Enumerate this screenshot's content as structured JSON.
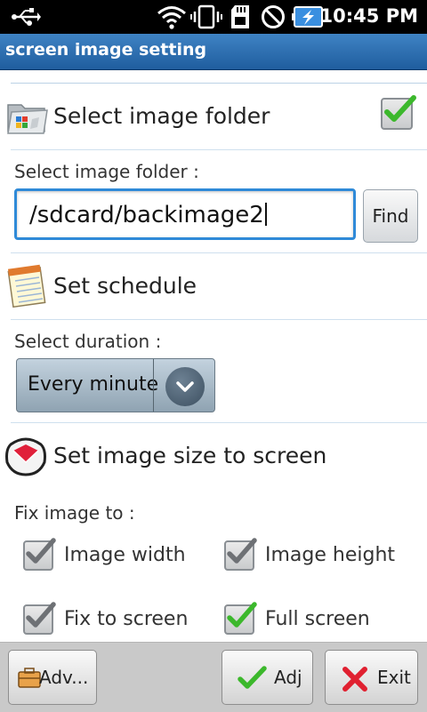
{
  "status_bar": {
    "time": "10:45 PM",
    "icons": [
      "usb-icon",
      "wifi-icon",
      "vibrate-icon",
      "sd-card-icon",
      "no-sound-icon",
      "battery-charging-icon"
    ]
  },
  "titlebar": {
    "title": "screen image setting"
  },
  "folder_section": {
    "title": "Select image folder",
    "checked": true,
    "field_label": "Select image folder :",
    "path_value": "/sdcard/backimage2",
    "find_label": "Find"
  },
  "schedule_section": {
    "title": "Set schedule",
    "duration_label": "Select duration :",
    "duration_value": "Every minute"
  },
  "size_section": {
    "title": "Set image size to screen",
    "fix_label": "Fix image to :",
    "options": [
      {
        "label": "Image width",
        "checked": false
      },
      {
        "label": "Image height",
        "checked": false
      },
      {
        "label": "Fix to screen",
        "checked": false
      },
      {
        "label": "Full screen",
        "checked": true
      }
    ]
  },
  "bottom_bar": {
    "adv_label": "Adv...",
    "adj_label": "Adj",
    "exit_label": "Exit"
  },
  "colors": {
    "title_blue": "#2b6fb3",
    "check_green": "#3cb82c",
    "exit_red": "#e02030",
    "focus_blue": "#2f8ad8"
  }
}
